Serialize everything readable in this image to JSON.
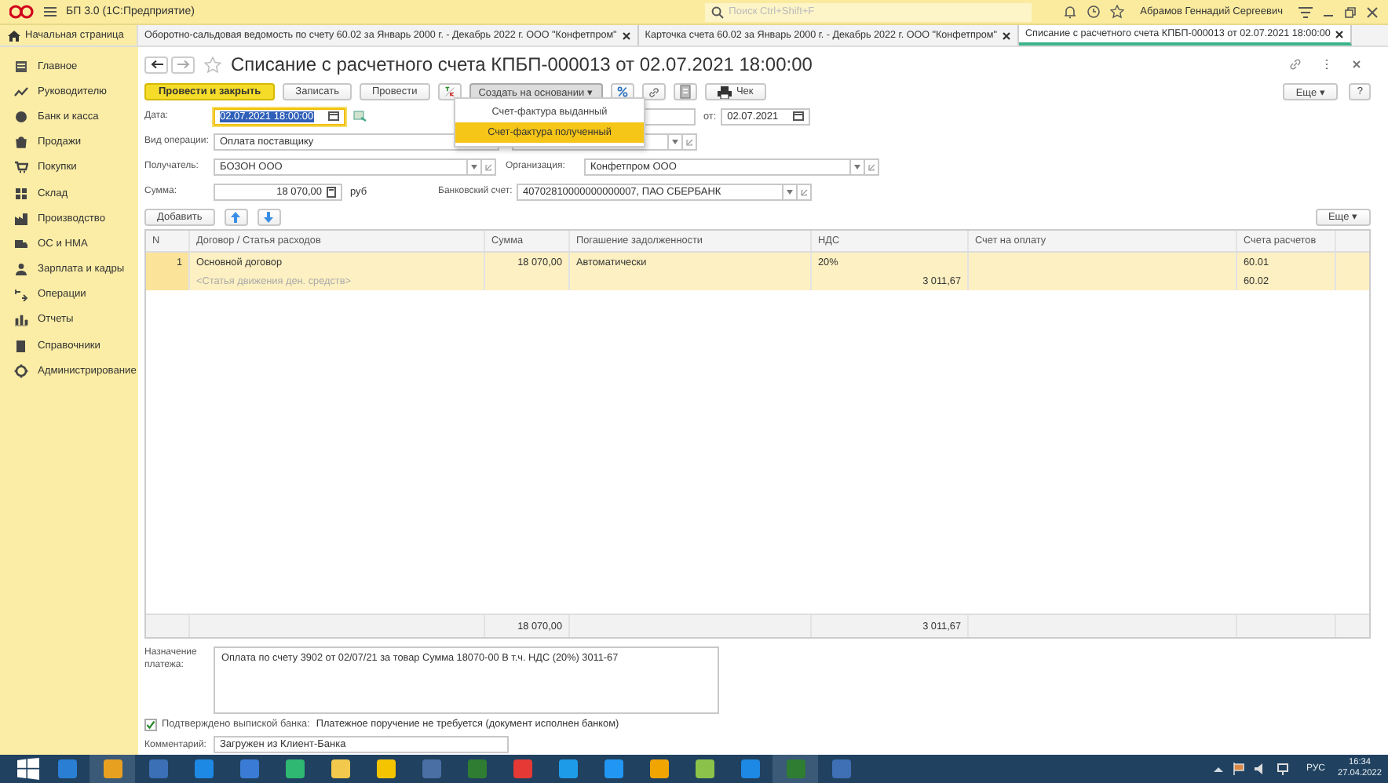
{
  "app": {
    "title": "БП 3.0  (1С:Предприятие)",
    "search": {
      "placeholder": "Поиск Ctrl+Shift+F"
    },
    "user": "Абрамов Геннадий Сергеевич"
  },
  "tabs": {
    "home": "Начальная страница",
    "items": [
      {
        "label": "Оборотно-сальдовая ведомость по счету 60.02 за Январь 2000 г. - Декабрь 2022 г. ООО \"Конфетпром\"",
        "selected": false
      },
      {
        "label": "Карточка счета 60.02 за Январь 2000 г. - Декабрь 2022 г. ООО \"Конфетпром\"",
        "selected": false
      },
      {
        "label": "Списание с расчетного счета КПБП-000013 от 02.07.2021 18:00:00",
        "selected": true
      }
    ]
  },
  "sidebar": {
    "items": [
      {
        "label": "Главное"
      },
      {
        "label": "Руководителю"
      },
      {
        "label": "Банк и касса"
      },
      {
        "label": "Продажи"
      },
      {
        "label": "Покупки"
      },
      {
        "label": "Склад"
      },
      {
        "label": "Производство"
      },
      {
        "label": "ОС и НМА"
      },
      {
        "label": "Зарплата и кадры"
      },
      {
        "label": "Операции"
      },
      {
        "label": "Отчеты"
      },
      {
        "label": "Справочники"
      },
      {
        "label": "Администрирование"
      }
    ]
  },
  "document": {
    "title": "Списание с расчетного счета КПБП-000013 от 02.07.2021 18:00:00",
    "more": "Еще ▾",
    "help": "?",
    "toolbar": [
      {
        "kind": "primary",
        "label": "Провести и закрыть"
      },
      {
        "kind": "plain",
        "label": "Записать"
      },
      {
        "kind": "plain",
        "label": "Провести"
      },
      {
        "kind": "dtkt"
      },
      {
        "kind": "dropdown",
        "label": "Создать на основании ▾",
        "expanded": true
      },
      {
        "kind": "percent"
      },
      {
        "kind": "link"
      },
      {
        "kind": "doc"
      },
      {
        "kind": "print",
        "label": "Чек"
      }
    ],
    "menu": [
      {
        "label": "Счет-фактура выданный",
        "selected": false
      },
      {
        "label": "Счет-фактура полученный",
        "selected": true
      }
    ],
    "date": {
      "label": "Дата:",
      "value": "02.07.2021 18:00:00"
    },
    "from": {
      "label": "от:",
      "value": "02.07.2021"
    },
    "operation": {
      "label": "Вид операции:",
      "value": "Оплата поставщику"
    },
    "recipient": {
      "label": "Получатель:",
      "value": "БОЗОН ООО"
    },
    "organization": {
      "label": "Организация:",
      "value": "Конфетпром ООО"
    },
    "amount": {
      "label": "Сумма:",
      "value": "18 070,00",
      "currency": "руб"
    },
    "bank_account": {
      "label": "Банковский счет:",
      "value": "40702810000000000007, ПАО СБЕРБАНК"
    }
  },
  "table": {
    "add": "Добавить",
    "more": "Еще ▾",
    "columns": [
      "N",
      "Договор / Статья расходов",
      "Сумма",
      "Погашение задолженности",
      "НДС",
      "Счет на оплату",
      "Счета расчетов"
    ],
    "rows": [
      {
        "n": "1",
        "contract": "Основной договор",
        "item": "<Статья движения ден. средств>",
        "sum": "18 070,00",
        "repayment": "Автоматически",
        "vat_rate": "20%",
        "vat_sum": "3 011,67",
        "invoice": "",
        "account_1": "60.01",
        "account_2": "60.02"
      }
    ],
    "totals": {
      "sum": "18 070,00",
      "vat": "3 011,67"
    }
  },
  "payment_purpose": {
    "label": "Назначение платежа:",
    "value": "Оплата по счету 3902 от 02/07/21 за товар Сумма 18070-00 В т.ч. НДС  (20%) 3011-67"
  },
  "bank_confirmed": {
    "label": "Подтверждено выпиской банка:",
    "checked": true,
    "note": "Платежное поручение не требуется (документ исполнен банком)"
  },
  "comment": {
    "label": "Комментарий:",
    "value": "Загружен из Клиент-Банка"
  },
  "taskbar": {
    "language": "РУС",
    "time": "16:34",
    "date": "27.04.2022"
  }
}
